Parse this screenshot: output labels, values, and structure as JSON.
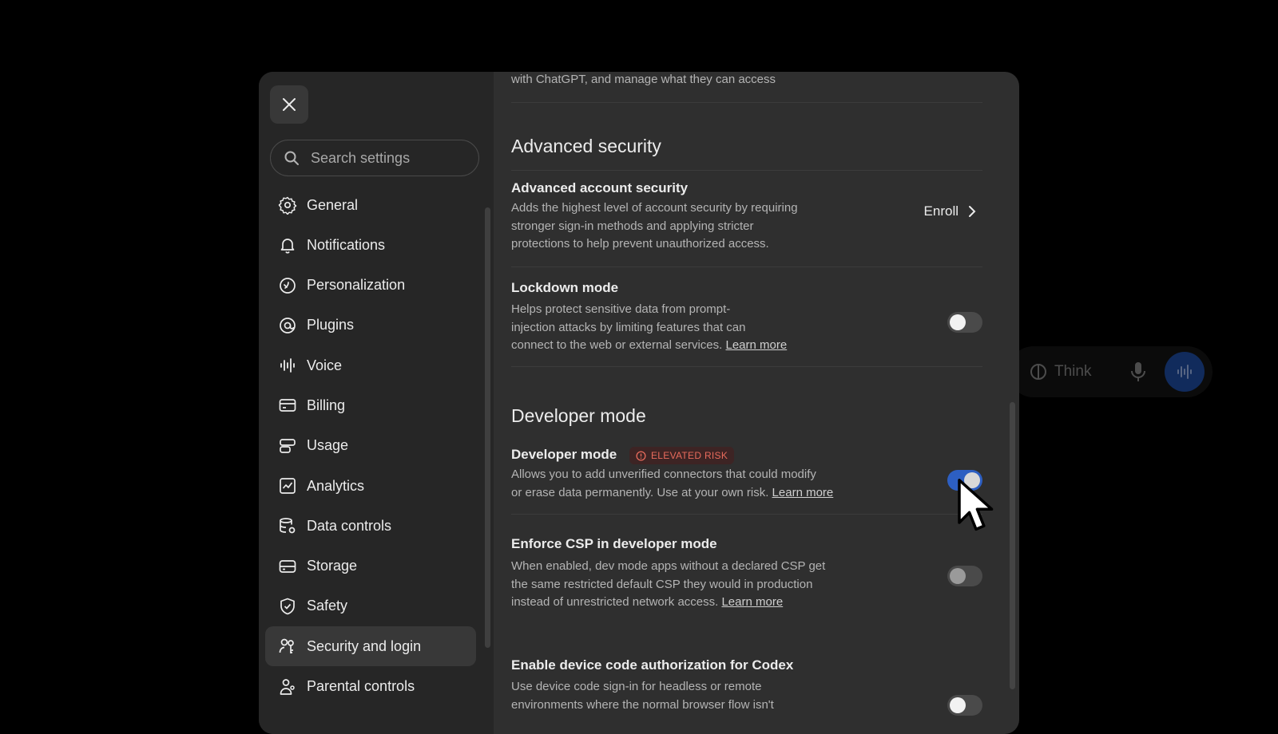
{
  "sidebar": {
    "search_placeholder": "Search settings",
    "items": [
      {
        "label": "General",
        "icon": "gear-icon"
      },
      {
        "label": "Notifications",
        "icon": "bell-icon"
      },
      {
        "label": "Personalization",
        "icon": "personalization-icon"
      },
      {
        "label": "Plugins",
        "icon": "plugins-icon"
      },
      {
        "label": "Voice",
        "icon": "voice-waveform-icon"
      },
      {
        "label": "Billing",
        "icon": "credit-card-icon"
      },
      {
        "label": "Usage",
        "icon": "usage-icon"
      },
      {
        "label": "Analytics",
        "icon": "chart-icon"
      },
      {
        "label": "Data controls",
        "icon": "database-gear-icon"
      },
      {
        "label": "Storage",
        "icon": "storage-icon"
      },
      {
        "label": "Safety",
        "icon": "shield-icon"
      },
      {
        "label": "Security and login",
        "icon": "key-person-icon",
        "active": true
      },
      {
        "label": "Parental controls",
        "icon": "parent-icon"
      }
    ]
  },
  "content": {
    "top_desc": "with ChatGPT, and manage what they can access",
    "advanced_security": {
      "section_title": "Advanced security",
      "account_security": {
        "title": "Advanced account security",
        "desc_lines": [
          "Adds the highest level of account security by requiring",
          "stronger sign-in methods and applying stricter",
          "protections to help prevent unauthorized access."
        ],
        "action_label": "Enroll"
      },
      "lockdown": {
        "title": "Lockdown mode",
        "desc_lines": [
          "Helps protect sensitive data from prompt-",
          "injection attacks by limiting features that can",
          "connect to the web or external services."
        ],
        "link": "Learn more",
        "enabled": false
      }
    },
    "developer": {
      "section_title": "Developer mode",
      "developer_mode": {
        "title": "Developer mode",
        "badge": "ELEVATED RISK",
        "desc_lines": [
          "Allows you to add unverified connectors that could modify",
          "or erase data permanently. Use at your own risk."
        ],
        "link": "Learn more",
        "enabled": true
      },
      "enforce_csp": {
        "title": "Enforce CSP in developer mode",
        "desc_lines": [
          "When enabled, dev mode apps without a declared CSP get",
          "the same restricted default CSP they would in production",
          "instead of unrestricted network access."
        ],
        "link": "Learn more",
        "enabled": false
      },
      "device_code": {
        "title": "Enable device code authorization for Codex",
        "desc_lines": [
          "Use device code sign-in for headless or remote",
          "environments where the normal browser flow isn't"
        ],
        "enabled": false
      }
    }
  },
  "composer": {
    "think_label": "Think"
  },
  "colors": {
    "accent": "#2d5fc2",
    "badge_text": "#e86b5c",
    "badge_bg": "#3d2424"
  }
}
